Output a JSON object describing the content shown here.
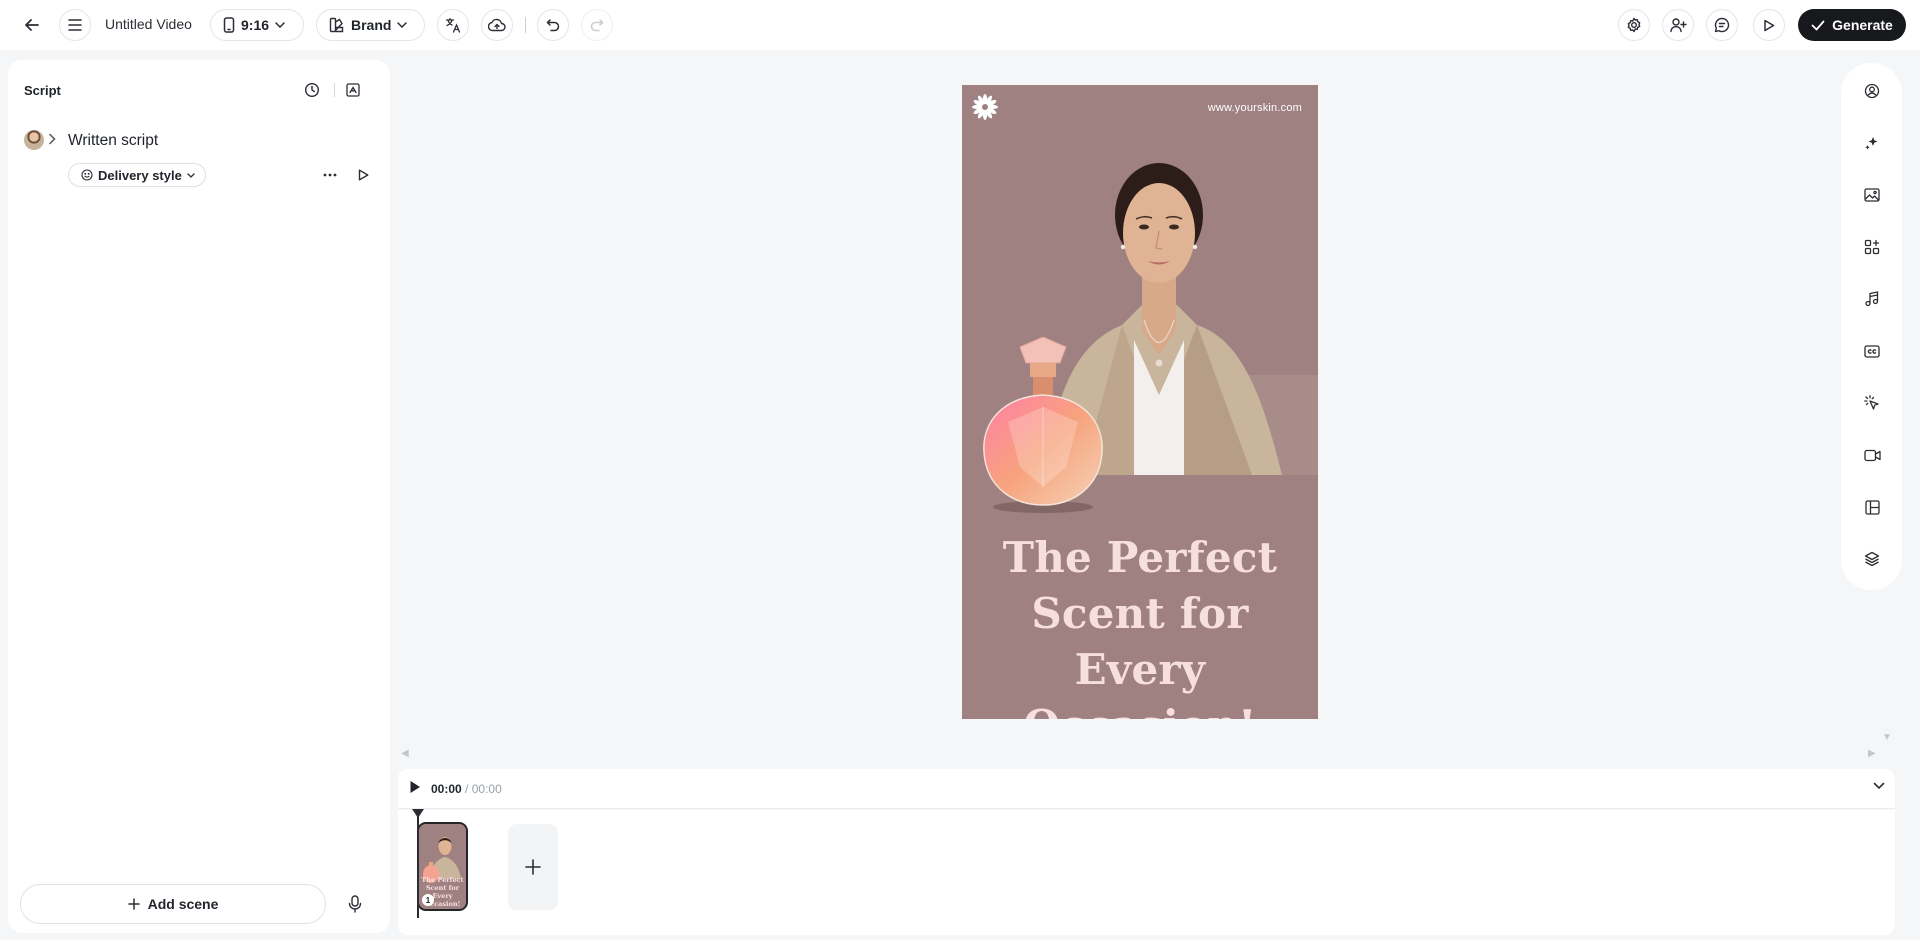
{
  "header": {
    "title": "Untitled Video",
    "aspect_ratio": "9:16",
    "brand_label": "Brand",
    "generate_label": "Generate"
  },
  "script_panel": {
    "title": "Script",
    "written_script_label": "Written script",
    "delivery_style_label": "Delivery style",
    "add_scene_label": "Add scene"
  },
  "canvas": {
    "url": "www.yourskin.com",
    "headline": "The Perfect Scent for Every Occasion!",
    "background_color": "#9e8180",
    "headline_color": "#f7dfe0"
  },
  "timeline": {
    "current_time": "00:00",
    "separator": " / ",
    "total_time": "00:00",
    "scenes": [
      {
        "number": "1",
        "thumb_text": "The Perfect Scent for Every Occasion!"
      }
    ]
  },
  "right_rail": {
    "icons": [
      "avatar-icon",
      "magic-sparkle-icon",
      "image-icon",
      "elements-icon",
      "music-icon",
      "captions-icon",
      "interaction-icon",
      "video-icon",
      "layout-icon",
      "layers-icon"
    ]
  },
  "colors": {
    "accent_dark": "#18191c",
    "page_background": "#f5f6f8"
  }
}
